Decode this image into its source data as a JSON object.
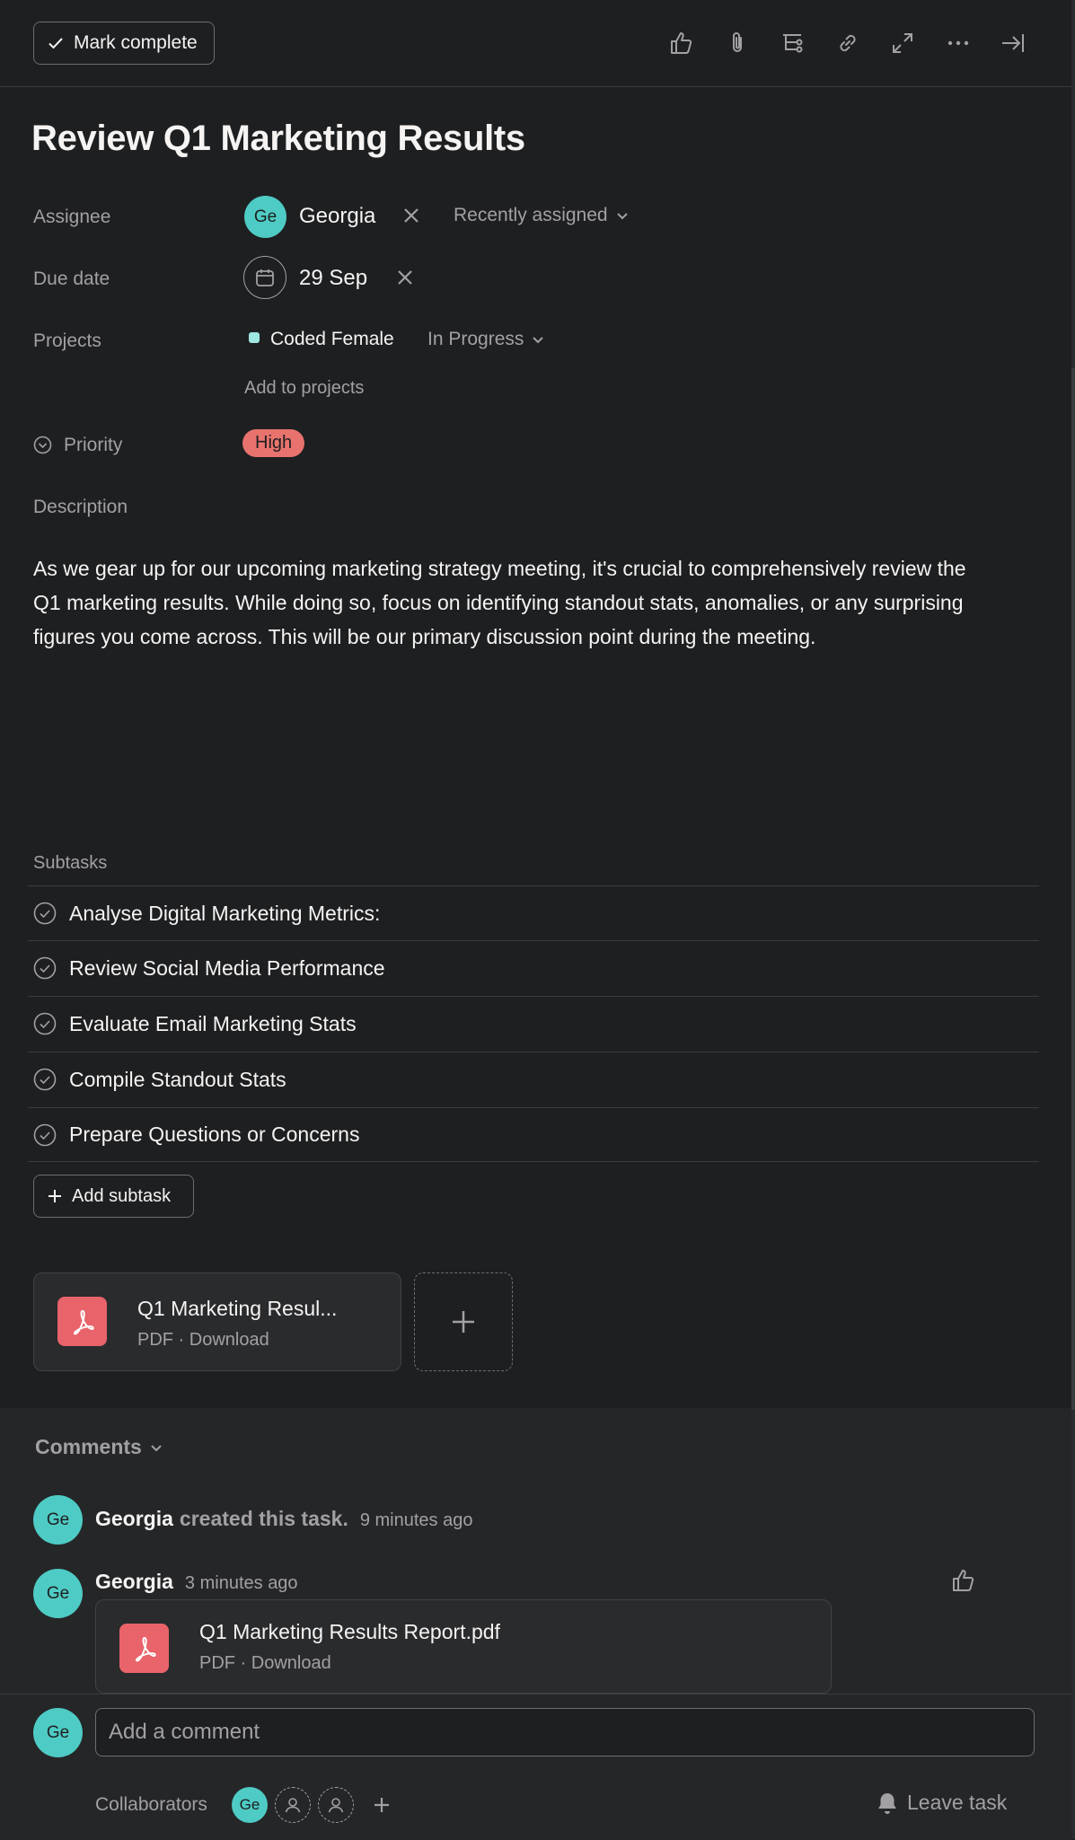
{
  "toolbar": {
    "mark_complete": "Mark complete",
    "icons": [
      "like-icon",
      "attachment-icon",
      "subtask-icon",
      "link-icon",
      "expand-icon",
      "more-icon",
      "close-panel-icon"
    ]
  },
  "task": {
    "title": "Review Q1 Marketing Results"
  },
  "fields": {
    "assignee_label": "Assignee",
    "assignee_initials": "Ge",
    "assignee_name": "Georgia",
    "recently_assigned": "Recently assigned",
    "due_date_label": "Due date",
    "due_date_value": "29 Sep",
    "projects_label": "Projects",
    "project_name": "Coded Female",
    "project_status": "In Progress",
    "add_to_projects": "Add to projects",
    "priority_label": "Priority",
    "priority_value": "High",
    "description_label": "Description"
  },
  "description": "As we gear up for our upcoming marketing strategy meeting, it's crucial to comprehensively review the Q1 marketing results. While doing so, focus on identifying standout stats, anomalies, or any surprising figures you come across. This will be our primary discussion point during the meeting.",
  "subtasks": {
    "label": "Subtasks",
    "items": [
      "Analyse Digital Marketing Metrics:",
      "Review Social Media Performance",
      "Evaluate Email Marketing Stats",
      "Compile Standout Stats",
      "Prepare Questions or Concerns"
    ],
    "add_label": "Add subtask"
  },
  "attachment": {
    "name": "Q1 Marketing Resul...",
    "meta": "PDF · Download"
  },
  "comments": {
    "header": "Comments",
    "activity": {
      "initials": "Ge",
      "user": "Georgia",
      "action": "created this task.",
      "time": "9 minutes ago"
    },
    "comment": {
      "initials": "Ge",
      "user": "Georgia",
      "time": "3 minutes ago",
      "file_name": "Q1 Marketing Results Report.pdf",
      "file_meta": "PDF · Download"
    }
  },
  "composer": {
    "initials": "Ge",
    "placeholder": "Add a comment",
    "collaborators_label": "Collaborators",
    "collaborator_initials": "Ge",
    "leave_task": "Leave task"
  },
  "colors": {
    "background": "#1e1f21",
    "avatar": "#4ecbc4",
    "priority_high": "#e8736e",
    "pdf": "#e8636a",
    "project_dot": "#9ee7e3"
  }
}
